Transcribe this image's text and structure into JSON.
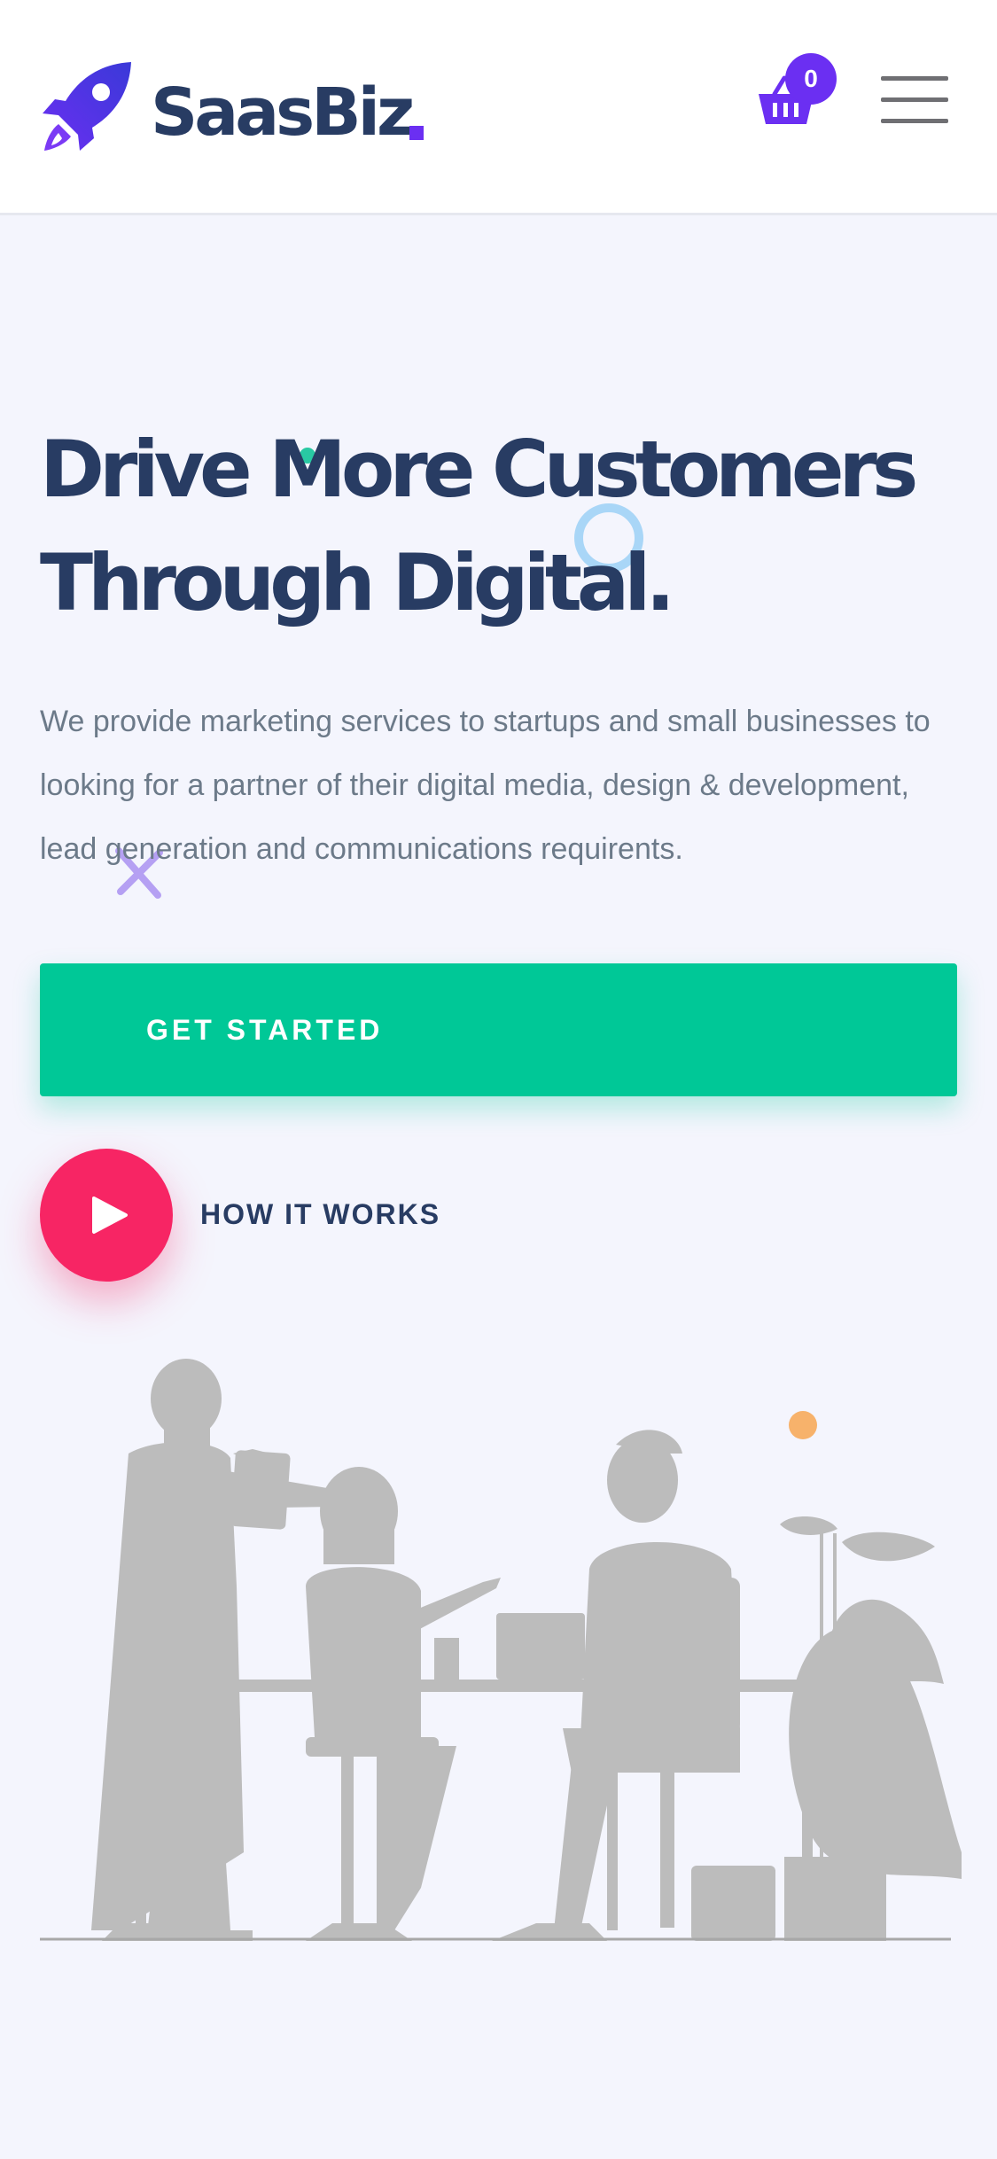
{
  "header": {
    "logo_text": "SaasBiz",
    "cart_count": "0",
    "brand_color": "#6b2ff2",
    "icons": [
      "rocket-icon",
      "cart-icon",
      "hamburger-menu-icon"
    ]
  },
  "hero": {
    "title_line1": "Drive More Customers",
    "title_line2": "Through Digital.",
    "description": "We provide marketing services to startups and small businesses to looking for a partner of their digital media, design & development, lead generation and communications requirents.",
    "cta_label": "GET STARTED",
    "how_it_works_label": "HOW IT WORKS"
  },
  "colors": {
    "heading": "#283c63",
    "body_text": "#6c7a89",
    "cta_green": "#00c897",
    "play_pink": "#f72564",
    "background": "#f4f5fd"
  }
}
